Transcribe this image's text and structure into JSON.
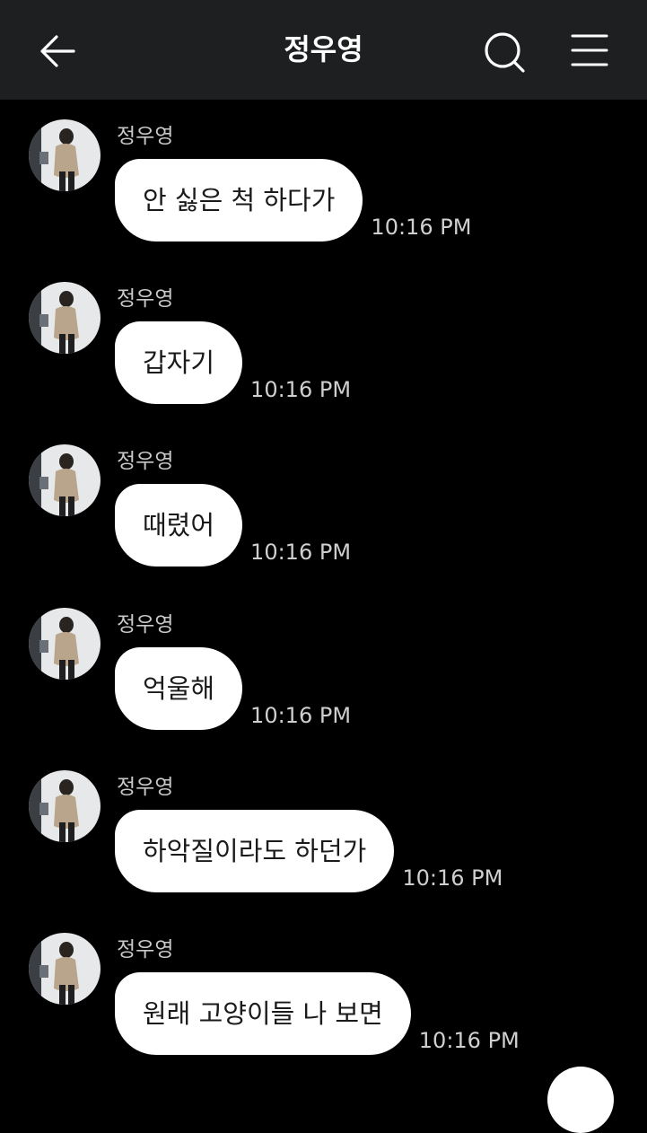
{
  "header": {
    "title": "정우영",
    "back_icon": "arrow-left-icon",
    "search_icon": "search-icon",
    "menu_icon": "hamburger-menu-icon"
  },
  "colors": {
    "header_bg": "#1e1f21",
    "chat_bg": "#000000",
    "bubble_bg": "#ffffff",
    "bubble_text": "#1a1a1a",
    "meta_text": "#cfcfcf"
  },
  "messages": [
    {
      "sender": "정우영",
      "text": "안 싫은 척 하다가",
      "time": "10:16 PM"
    },
    {
      "sender": "정우영",
      "text": "갑자기",
      "time": "10:16 PM"
    },
    {
      "sender": "정우영",
      "text": "때렸어",
      "time": "10:16 PM"
    },
    {
      "sender": "정우영",
      "text": "억울해",
      "time": "10:16 PM"
    },
    {
      "sender": "정우영",
      "text": "하악질이라도 하던가",
      "time": "10:16 PM"
    },
    {
      "sender": "정우영",
      "text": "원래 고양이들 나 보면",
      "time": "10:16 PM"
    }
  ]
}
